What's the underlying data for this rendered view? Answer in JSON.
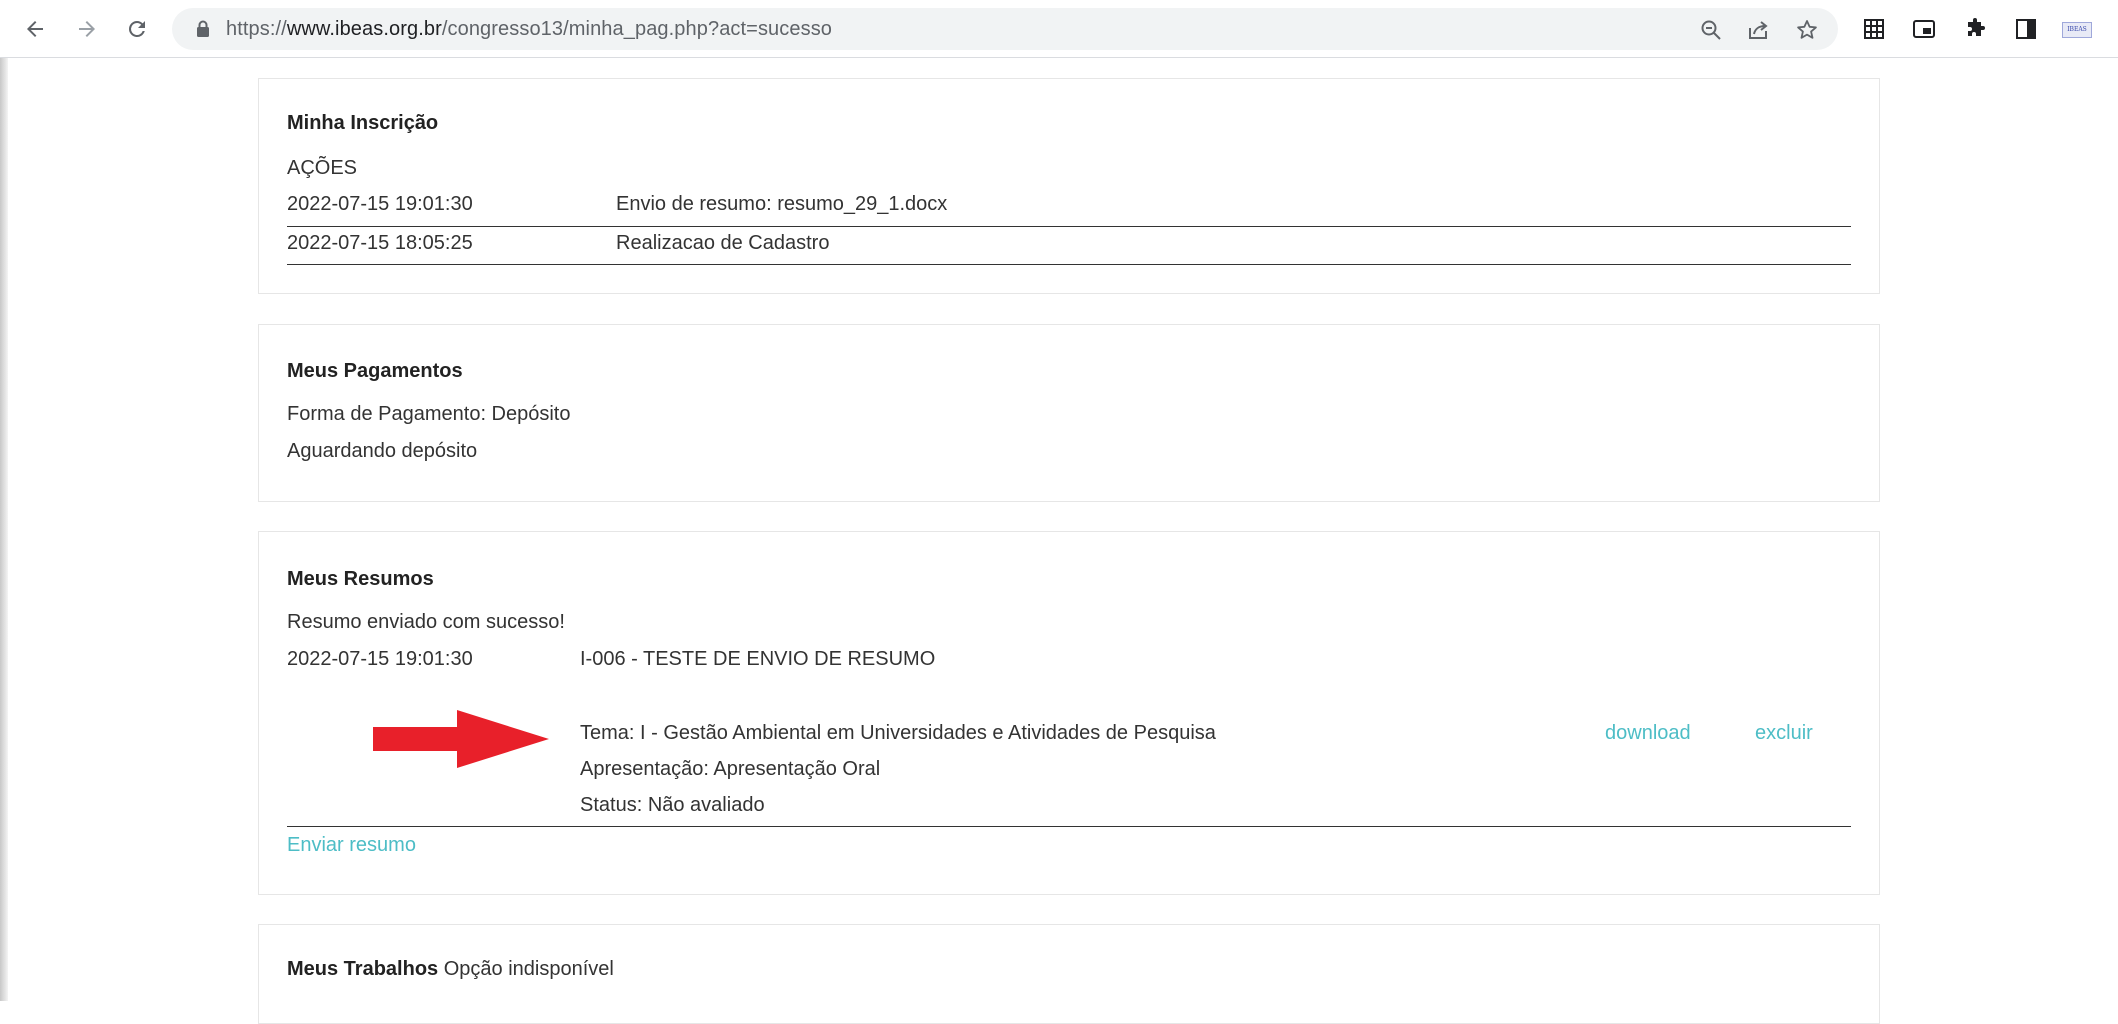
{
  "browser": {
    "url_scheme": "https://",
    "url_host": "www.ibeas.org.br",
    "url_path": "/congresso13/minha_pag.php?act=sucesso",
    "profile_badge": "IBEAS"
  },
  "inscricao": {
    "title": "Minha Inscrição",
    "acoes_label": "AÇÕES",
    "rows": [
      {
        "date": "2022-07-15 19:01:30",
        "action": "Envio de resumo: resumo_29_1.docx"
      },
      {
        "date": "2022-07-15 18:05:25",
        "action": "Realizacao de Cadastro"
      }
    ]
  },
  "pagamentos": {
    "title": "Meus Pagamentos",
    "forma": "Forma de Pagamento: Depósito",
    "status": "Aguardando depósito"
  },
  "resumos": {
    "title": "Meus Resumos",
    "message": "Resumo enviado com sucesso!",
    "item": {
      "date": "2022-07-15 19:01:30",
      "title": "I-006 - TESTE DE ENVIO DE RESUMO",
      "tema": "Tema: I - Gestão Ambiental em Universidades e Atividades de Pesquisa",
      "apresentacao": "Apresentação: Apresentação Oral",
      "status": "Status: Não avaliado",
      "download_label": "download",
      "excluir_label": "excluir"
    },
    "enviar_label": "Enviar resumo"
  },
  "trabalhos": {
    "title": "Meus Trabalhos",
    "status": "Opção indisponível"
  },
  "colors": {
    "link": "#4dbdc6",
    "annotation_arrow": "#e8202a"
  }
}
